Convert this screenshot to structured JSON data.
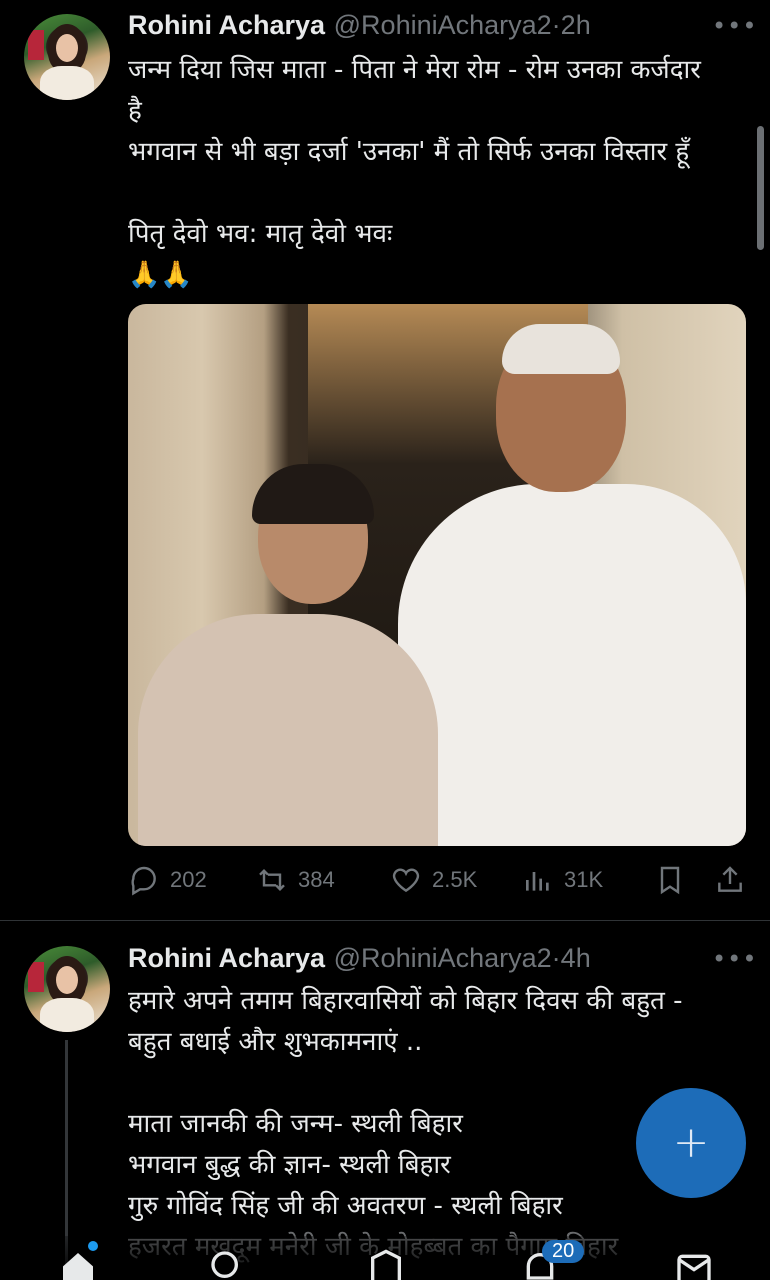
{
  "tweets": [
    {
      "name": "Rohini Acharya",
      "handle": "@RohiniAcharya2",
      "separator": "·",
      "time": "2h",
      "more": "•••",
      "lines": [
        "जन्म दिया जिस माता - पिता ने मेरा रोम - रोम उनका कर्जदार",
        "है",
        "भगवान से भी बड़ा दर्जा 'उनका' मैं तो सिर्फ उनका विस्तार हूँ",
        "",
        "पितृ देवो भव: मातृ देवो भवः",
        "🙏🙏"
      ],
      "stats": {
        "replies": "202",
        "retweets": "384",
        "likes": "2.5K",
        "views": "31K"
      }
    },
    {
      "name": "Rohini Acharya",
      "handle": "@RohiniAcharya2",
      "separator": "·",
      "time": "4h",
      "more": "•••",
      "lines": [
        "हमारे अपने तमाम बिहारवासियों को बिहार दिवस की बहुत -",
        "बहुत बधाई और शुभकामनाएं ..",
        "",
        "माता जानकी की जन्म- स्थली बिहार",
        "भगवान बुद्ध की ज्ञान- स्थली बिहार",
        "गुरु गोविंद सिंह जी की अवतरण - स्थली बिहार",
        "हजरत मखदूम मनेरी जी के मोहब्बत का पैगाम बिहार"
      ]
    }
  ],
  "fab": {
    "label": "+"
  },
  "nav": {
    "notifications_badge": "20"
  },
  "icons": {
    "reply": "reply-icon",
    "retweet": "retweet-icon",
    "like": "heart-icon",
    "views": "views-icon",
    "bookmark": "bookmark-icon",
    "share": "share-icon"
  },
  "colors": {
    "accent": "#1d9bf0",
    "fab": "#1d6cb8",
    "muted": "#71767b"
  }
}
